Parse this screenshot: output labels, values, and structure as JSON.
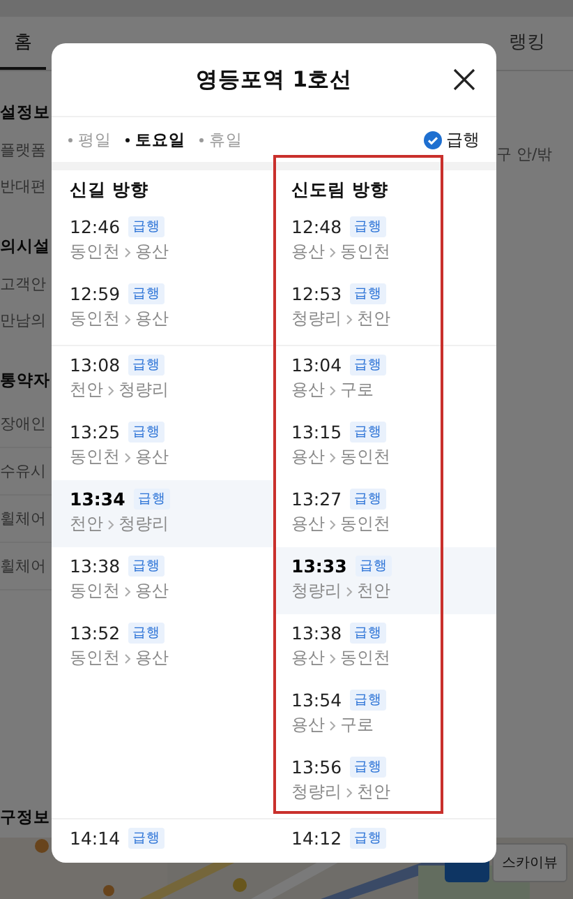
{
  "page": {
    "tabs": [
      {
        "label": "홈",
        "selected": true
      },
      {
        "label": "랭킹",
        "selected": false
      }
    ],
    "left_fragments": [
      {
        "text": "설정보",
        "kind": "heading"
      },
      {
        "text": "플랫폼",
        "kind": "item"
      },
      {
        "text": "반대편",
        "kind": "item"
      },
      {
        "text": "의시설",
        "kind": "heading"
      },
      {
        "text": "고객안",
        "kind": "item"
      },
      {
        "text": "만남의",
        "kind": "item"
      },
      {
        "text": "통약자",
        "kind": "heading"
      },
      {
        "text": "장애인",
        "kind": "row"
      },
      {
        "text": "수유시",
        "kind": "row"
      },
      {
        "text": "휠체어",
        "kind": "row"
      },
      {
        "text": "휠체어",
        "kind": "row"
      },
      {
        "text": "구정보",
        "kind": "footer"
      }
    ],
    "right_fragments": [
      {
        "text": "구 안/밖"
      }
    ],
    "map": {
      "kind": "picture",
      "button": "스카이뷰"
    }
  },
  "dialog": {
    "title": "영등포역 1호선",
    "day_filters": [
      {
        "label": "평일",
        "selected": false
      },
      {
        "label": "토요일",
        "selected": true
      },
      {
        "label": "휴일",
        "selected": false
      }
    ],
    "express_filter": {
      "label": "급행",
      "checked": true
    },
    "directions": [
      "신길 방향",
      "신도림 방향"
    ],
    "groups": [
      {
        "columns": [
          [
            {
              "time": "12:46",
              "badge": "급행",
              "from": "동인천",
              "to": "용산",
              "current": false
            },
            {
              "time": "12:59",
              "badge": "급행",
              "from": "동인천",
              "to": "용산",
              "current": false
            }
          ],
          [
            {
              "time": "12:48",
              "badge": "급행",
              "from": "용산",
              "to": "동인천",
              "current": false
            },
            {
              "time": "12:53",
              "badge": "급행",
              "from": "청량리",
              "to": "천안",
              "current": false
            }
          ]
        ]
      },
      {
        "columns": [
          [
            {
              "time": "13:08",
              "badge": "급행",
              "from": "천안",
              "to": "청량리",
              "current": false
            },
            {
              "time": "13:25",
              "badge": "급행",
              "from": "동인천",
              "to": "용산",
              "current": false
            },
            {
              "time": "13:34",
              "badge": "급행",
              "from": "천안",
              "to": "청량리",
              "current": true
            },
            {
              "time": "13:38",
              "badge": "급행",
              "from": "동인천",
              "to": "용산",
              "current": false
            },
            {
              "time": "13:52",
              "badge": "급행",
              "from": "동인천",
              "to": "용산",
              "current": false
            }
          ],
          [
            {
              "time": "13:04",
              "badge": "급행",
              "from": "용산",
              "to": "구로",
              "current": false
            },
            {
              "time": "13:15",
              "badge": "급행",
              "from": "용산",
              "to": "동인천",
              "current": false
            },
            {
              "time": "13:27",
              "badge": "급행",
              "from": "용산",
              "to": "동인천",
              "current": false
            },
            {
              "time": "13:33",
              "badge": "급행",
              "from": "청량리",
              "to": "천안",
              "current": true
            },
            {
              "time": "13:38",
              "badge": "급행",
              "from": "용산",
              "to": "동인천",
              "current": false
            },
            {
              "time": "13:54",
              "badge": "급행",
              "from": "용산",
              "to": "구로",
              "current": false
            },
            {
              "time": "13:56",
              "badge": "급행",
              "from": "청량리",
              "to": "천안",
              "current": false
            }
          ]
        ]
      },
      {
        "columns": [
          [
            {
              "time": "14:14",
              "badge": "급행",
              "current": false
            }
          ],
          [
            {
              "time": "14:12",
              "badge": "급행",
              "current": false
            }
          ]
        ]
      }
    ]
  }
}
